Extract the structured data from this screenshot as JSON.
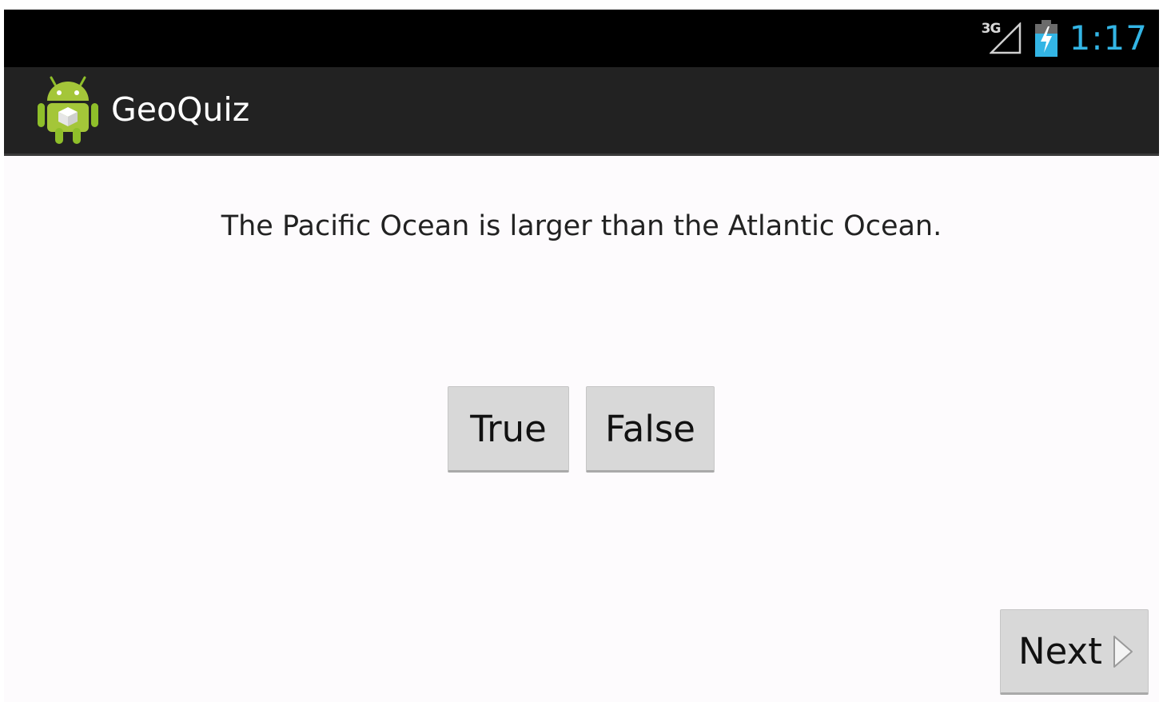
{
  "status_bar": {
    "network_type": "3G",
    "signal_icon": "signal-icon",
    "battery_icon": "battery-charging-icon",
    "clock": "1:17",
    "clock_color": "#33b5e5"
  },
  "action_bar": {
    "app_icon": "android-robot-icon",
    "title": "GeoQuiz"
  },
  "quiz": {
    "question": "The Pacific Ocean is larger than the Atlantic Ocean.",
    "true_label": "True",
    "false_label": "False",
    "next_label": "Next",
    "next_icon": "chevron-right-icon"
  }
}
